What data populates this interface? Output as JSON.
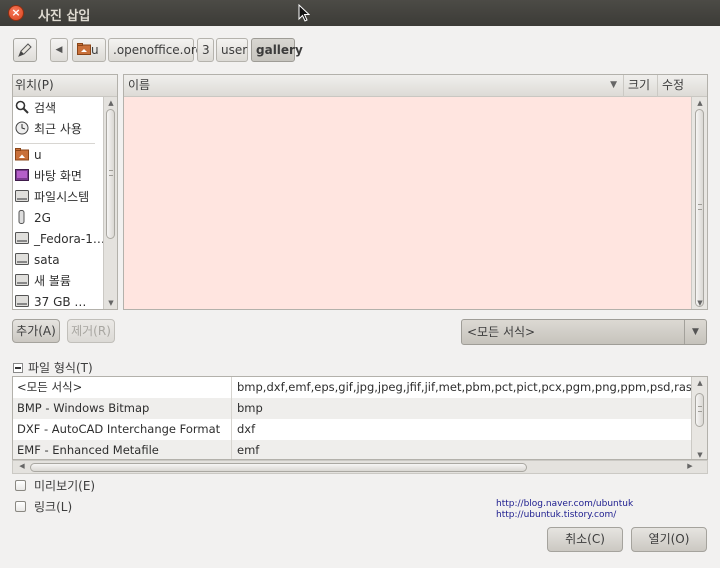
{
  "window": {
    "title": "사진 삽입"
  },
  "pathbar": {
    "crumbs": [
      "u",
      ".openoffice.org",
      "3",
      "user",
      "gallery"
    ]
  },
  "places": {
    "header": "위치(P)",
    "items": [
      {
        "label": "검색",
        "icon": "search-icon"
      },
      {
        "label": "최근 사용",
        "icon": "clock-icon"
      },
      {
        "label": "u",
        "icon": "home-folder-icon"
      },
      {
        "label": "바탕 화면",
        "icon": "desktop-icon"
      },
      {
        "label": "파일시스템",
        "icon": "drive-icon"
      },
      {
        "label": "2G",
        "icon": "usb-drive-icon"
      },
      {
        "label": "_Fedora-1…",
        "icon": "drive-icon"
      },
      {
        "label": "sata",
        "icon": "drive-icon"
      },
      {
        "label": "새 볼륨",
        "icon": "drive-icon"
      },
      {
        "label": "37 GB …",
        "icon": "drive-icon"
      }
    ],
    "add_button": "추가(A)",
    "remove_button": "제거(R)"
  },
  "files": {
    "columns": {
      "name": "이름",
      "size": "크기",
      "modified": "수정"
    }
  },
  "filter": {
    "selected": "<모든 서식>"
  },
  "filetypes": {
    "expander_label": "파일 형식(T)",
    "rows": [
      {
        "name": "<모든 서식>",
        "ext": "bmp,dxf,emf,eps,gif,jpg,jpeg,jfif,jif,met,pbm,pct,pict,pcx,pgm,png,ppm,psd,ras,sgf,sgv"
      },
      {
        "name": "BMP - Windows Bitmap",
        "ext": "bmp"
      },
      {
        "name": "DXF - AutoCAD Interchange Format",
        "ext": "dxf"
      },
      {
        "name": "EMF - Enhanced Metafile",
        "ext": "emf"
      }
    ]
  },
  "options": {
    "preview": "미리보기(E)",
    "link": "링크(L)"
  },
  "watermark": {
    "line1": "http://blog.naver.com/ubuntuk",
    "line2": "http://ubuntuk.tistory.com/"
  },
  "actions": {
    "cancel": "취소(C)",
    "open": "열기(O)"
  }
}
